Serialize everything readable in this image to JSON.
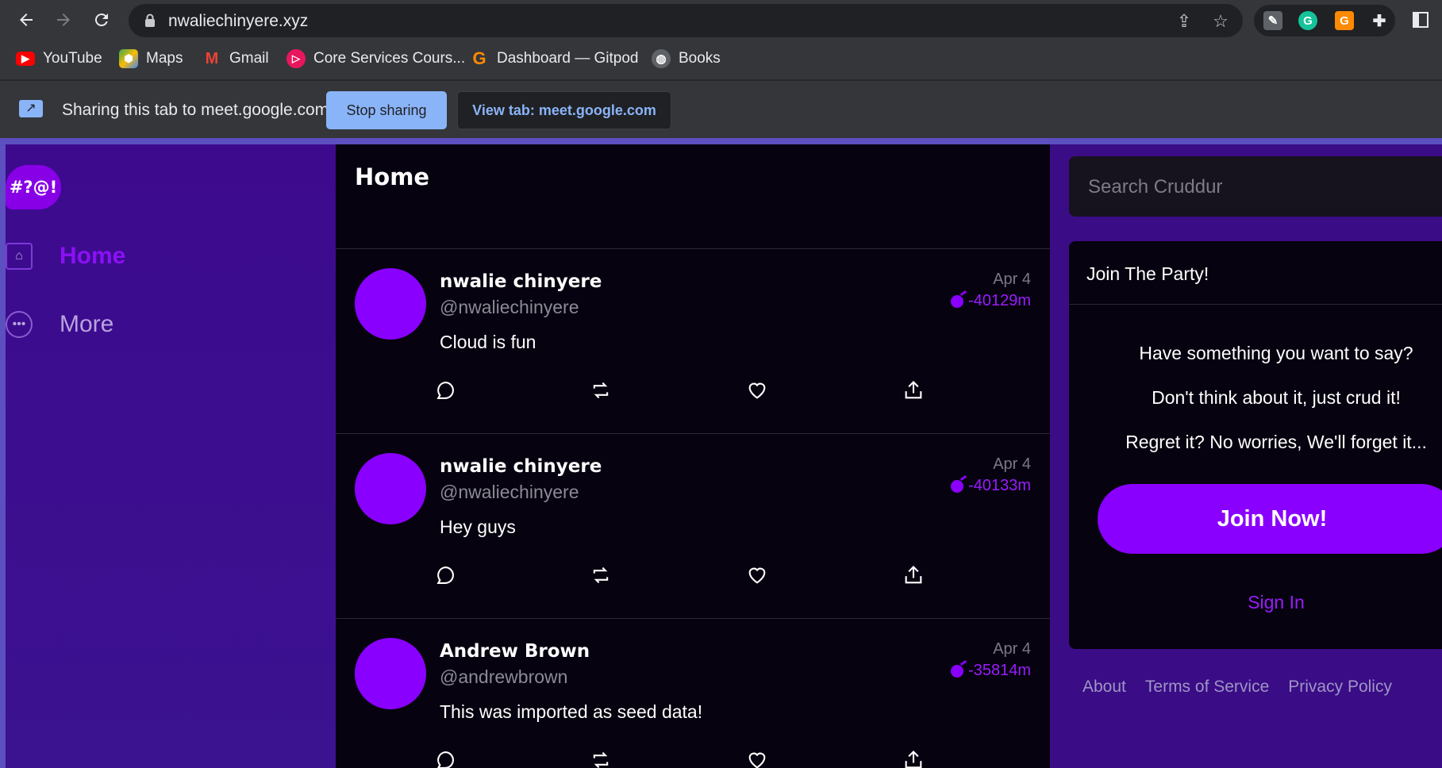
{
  "browser": {
    "url": "nwaliechinyere.xyz",
    "bookmarks": [
      {
        "label": "YouTube",
        "icon": "youtube-icon",
        "color": "#ff0000"
      },
      {
        "label": "Maps",
        "icon": "maps-icon",
        "color": "#34a853"
      },
      {
        "label": "Gmail",
        "icon": "gmail-icon",
        "color": "#ea4335"
      },
      {
        "label": "Core Services Cours...",
        "icon": "course-icon",
        "color": "#e8175d"
      },
      {
        "label": "Dashboard — Gitpod",
        "icon": "gitpod-icon",
        "color": "#ff8a00"
      },
      {
        "label": "Books",
        "icon": "globe-icon",
        "color": "#9aa0a6"
      }
    ]
  },
  "share_bar": {
    "message": "Sharing this tab to meet.google.com",
    "stop_label": "Stop sharing",
    "view_label": "View tab: meet.google.com"
  },
  "app": {
    "logo_text": "#?@!",
    "nav": {
      "home": "Home",
      "more": "More"
    },
    "feed": {
      "title": "Home",
      "posts": [
        {
          "name": "nwalie chinyere",
          "handle": "@nwaliechinyere",
          "text": "Cloud is fun",
          "date": "Apr 4",
          "expires": "-40129m"
        },
        {
          "name": "nwalie chinyere",
          "handle": "@nwaliechinyere",
          "text": "Hey guys",
          "date": "Apr 4",
          "expires": "-40133m"
        },
        {
          "name": "Andrew Brown",
          "handle": "@andrewbrown",
          "text": "This was imported as seed data!",
          "date": "Apr 4",
          "expires": "-35814m"
        }
      ]
    },
    "sidebar": {
      "search_placeholder": "Search Cruddur",
      "party": {
        "title": "Join The Party!",
        "line1": "Have something you want to say?",
        "line2": "Don't think about it, just crud it!",
        "line3": "Regret it? No worries, We'll forget it...",
        "join_label": "Join Now!",
        "signin_label": "Sign In"
      },
      "footer": {
        "about": "About",
        "terms": "Terms of Service",
        "privacy": "Privacy Policy"
      }
    },
    "colors": {
      "accent": "#8a00ff",
      "nav_bg": "#3d0a8e",
      "feed_bg": "#06020f"
    }
  }
}
